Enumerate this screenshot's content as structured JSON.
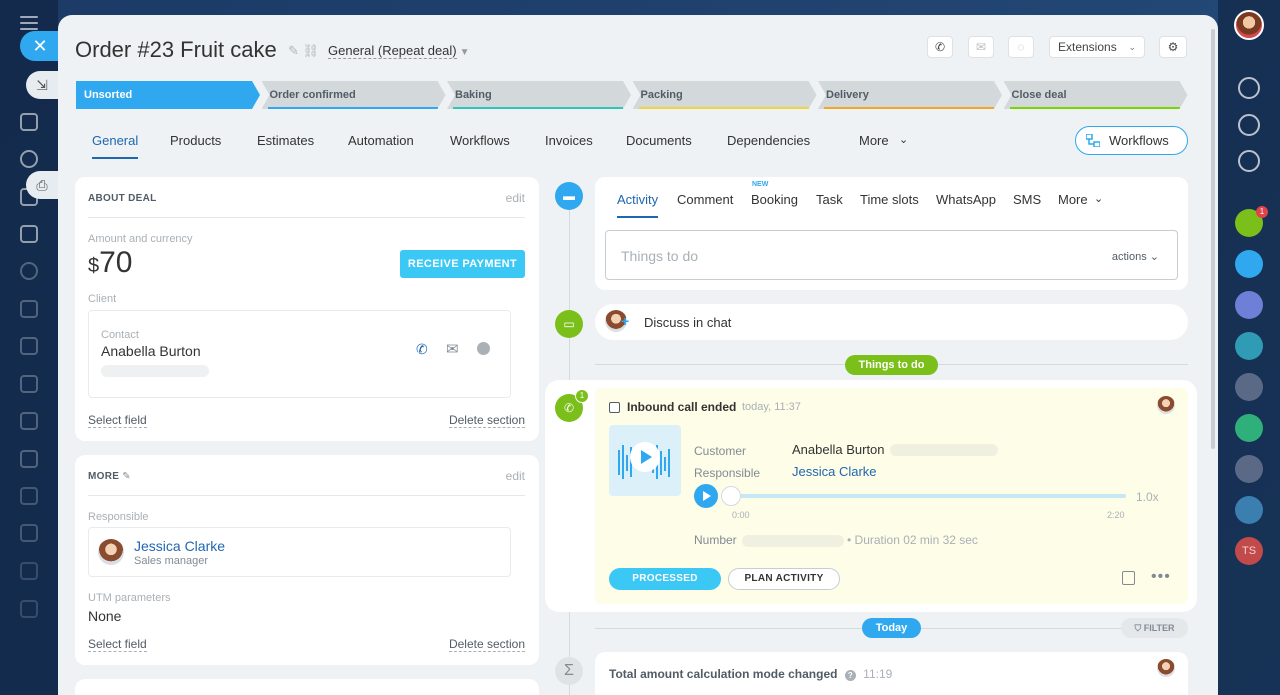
{
  "title": "Order #23 Fruit cake",
  "category": "General (Repeat deal)",
  "extensions_label": "Extensions",
  "stages": [
    {
      "label": "Unsorted",
      "color": "#2fa8f0"
    },
    {
      "label": "Order confirmed",
      "color": "#2fa8f0"
    },
    {
      "label": "Baking",
      "color": "#2fc6b8"
    },
    {
      "label": "Packing",
      "color": "#f3d43b"
    },
    {
      "label": "Delivery",
      "color": "#f5a623"
    },
    {
      "label": "Close deal",
      "color": "#7bd500"
    }
  ],
  "tabs": [
    "General",
    "Products",
    "Estimates",
    "Automation",
    "Workflows",
    "Invoices",
    "Documents",
    "Dependencies",
    "More"
  ],
  "workflows_button": "Workflows",
  "about": {
    "title": "ABOUT DEAL",
    "edit": "edit",
    "amount_label": "Amount and currency",
    "currency": "$",
    "amount": "70",
    "receive_payment": "RECEIVE PAYMENT",
    "client_label": "Client",
    "contact_label": "Contact",
    "contact_name": "Anabella Burton",
    "select_field": "Select field",
    "delete_section": "Delete section"
  },
  "more": {
    "title": "MORE",
    "edit": "edit",
    "responsible_label": "Responsible",
    "responsible_name": "Jessica Clarke",
    "responsible_role": "Sales manager",
    "utm_label": "UTM parameters",
    "utm_value": "None",
    "select_field": "Select field",
    "delete_section": "Delete section"
  },
  "editor_tabs": [
    "Activity",
    "Comment",
    "Booking",
    "Task",
    "Time slots",
    "WhatsApp",
    "SMS",
    "More"
  ],
  "new_tag": "NEW",
  "todo_placeholder": "Things to do",
  "actions_label": "actions",
  "discuss_chat": "Discuss in chat",
  "things_to_do_pill": "Things to do",
  "call": {
    "badge": "1",
    "title": "Inbound call ended",
    "time": "today, 11:37",
    "customer_label": "Customer",
    "customer_name": "Anabella Burton",
    "responsible_label": "Responsible",
    "responsible_name": "Jessica Clarke",
    "speed": "1.0x",
    "start": "0:00",
    "end": "2:20",
    "number_label": "Number",
    "duration": "• Duration 02 min 32 sec",
    "processed": "PROCESSED",
    "plan_activity": "PLAN ACTIVITY"
  },
  "today_pill": "Today",
  "filter": "FILTER",
  "history": {
    "title": "Total amount calculation mode changed",
    "time": "11:19"
  },
  "right_rail": {
    "ts": "TS",
    "badge": "1"
  },
  "colors": {
    "accent": "#2fa8f0",
    "green": "#7bbf1a",
    "link": "#2067b0"
  }
}
